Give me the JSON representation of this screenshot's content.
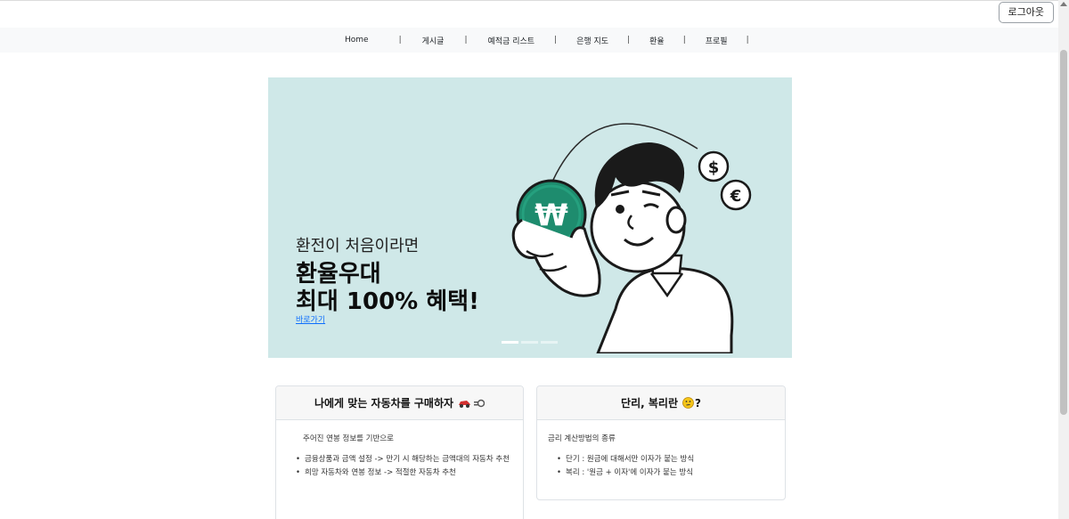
{
  "auth": {
    "logout_label": "로그아웃"
  },
  "nav": {
    "items": [
      {
        "label": "Home"
      },
      {
        "label": "게시글"
      },
      {
        "label": "예적금 리스트"
      },
      {
        "label": "은행 지도"
      },
      {
        "label": "환율"
      },
      {
        "label": "프로필"
      }
    ],
    "separator": "|"
  },
  "banner": {
    "subtitle": "환전이 처음이라면",
    "title_line1": "환율우대",
    "title_line2": "최대 100% 혜택!",
    "link_label": "바로가기",
    "slide_count": 3,
    "active_slide": 1,
    "coin_symbol": "₩",
    "dollar_symbol": "$",
    "euro_symbol": "€",
    "bg_color": "#cfe8e8",
    "coin_color": "#1e8c6e"
  },
  "cards": {
    "car": {
      "title": "나에게 맞는 자동차를 구매하자",
      "lead": "주어진 연봉 정보를 기반으로",
      "items": [
        "금융상품과 금액 설정 -> 만기 시 해당하는 금액대의 자동차 추천",
        "희망 자동차와 연봉 정보 -> 적절한 자동차 추천"
      ]
    },
    "interest": {
      "title": "단리, 복리란",
      "title_suffix": "?",
      "lead": "금리 계산방법의 종류",
      "items": [
        "단기 : 원금에 대해서만 이자가 붙는 방식",
        "복리 : '원금 + 이자'에 이자가 붙는 방식"
      ]
    }
  },
  "colors": {
    "link": "#0d6efd",
    "navbar_bg": "#f8f9fa",
    "card_header_bg": "#f7f7f7"
  }
}
